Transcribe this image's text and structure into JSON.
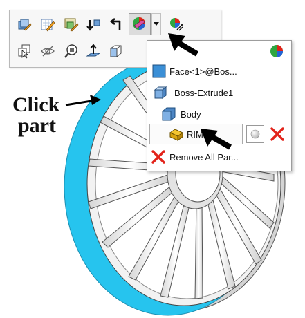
{
  "callout": {
    "line1": "Click",
    "line2": "part"
  },
  "toolbar": {
    "row1_icons": [
      "edit-part-icon",
      "edit-sketch-icon",
      "edit-feature-icon",
      "rollback-icon",
      "parent-child-icon",
      "appearance-icon",
      "dropdown-icon",
      "hide-show-appearance-icon"
    ],
    "row2_icons": [
      "select-other-icon",
      "hide-icon",
      "zoom-to-selection-icon",
      "normal-to-icon",
      "view-orientation-icon"
    ]
  },
  "menu": {
    "items": [
      {
        "label": "Face<1>@Bos...",
        "icon": "face-icon"
      },
      {
        "label": "Boss-Extrude1",
        "icon": "feature-icon"
      },
      {
        "label": "Body",
        "icon": "body-icon"
      },
      {
        "label": "RIM",
        "icon": "part-icon"
      },
      {
        "label": "Remove All Par...",
        "icon": "remove-icon"
      }
    ]
  },
  "colors": {
    "rim_highlight": "#26c4ee",
    "remove_red": "#e2231a",
    "face_blue": "#3b8fd6"
  }
}
